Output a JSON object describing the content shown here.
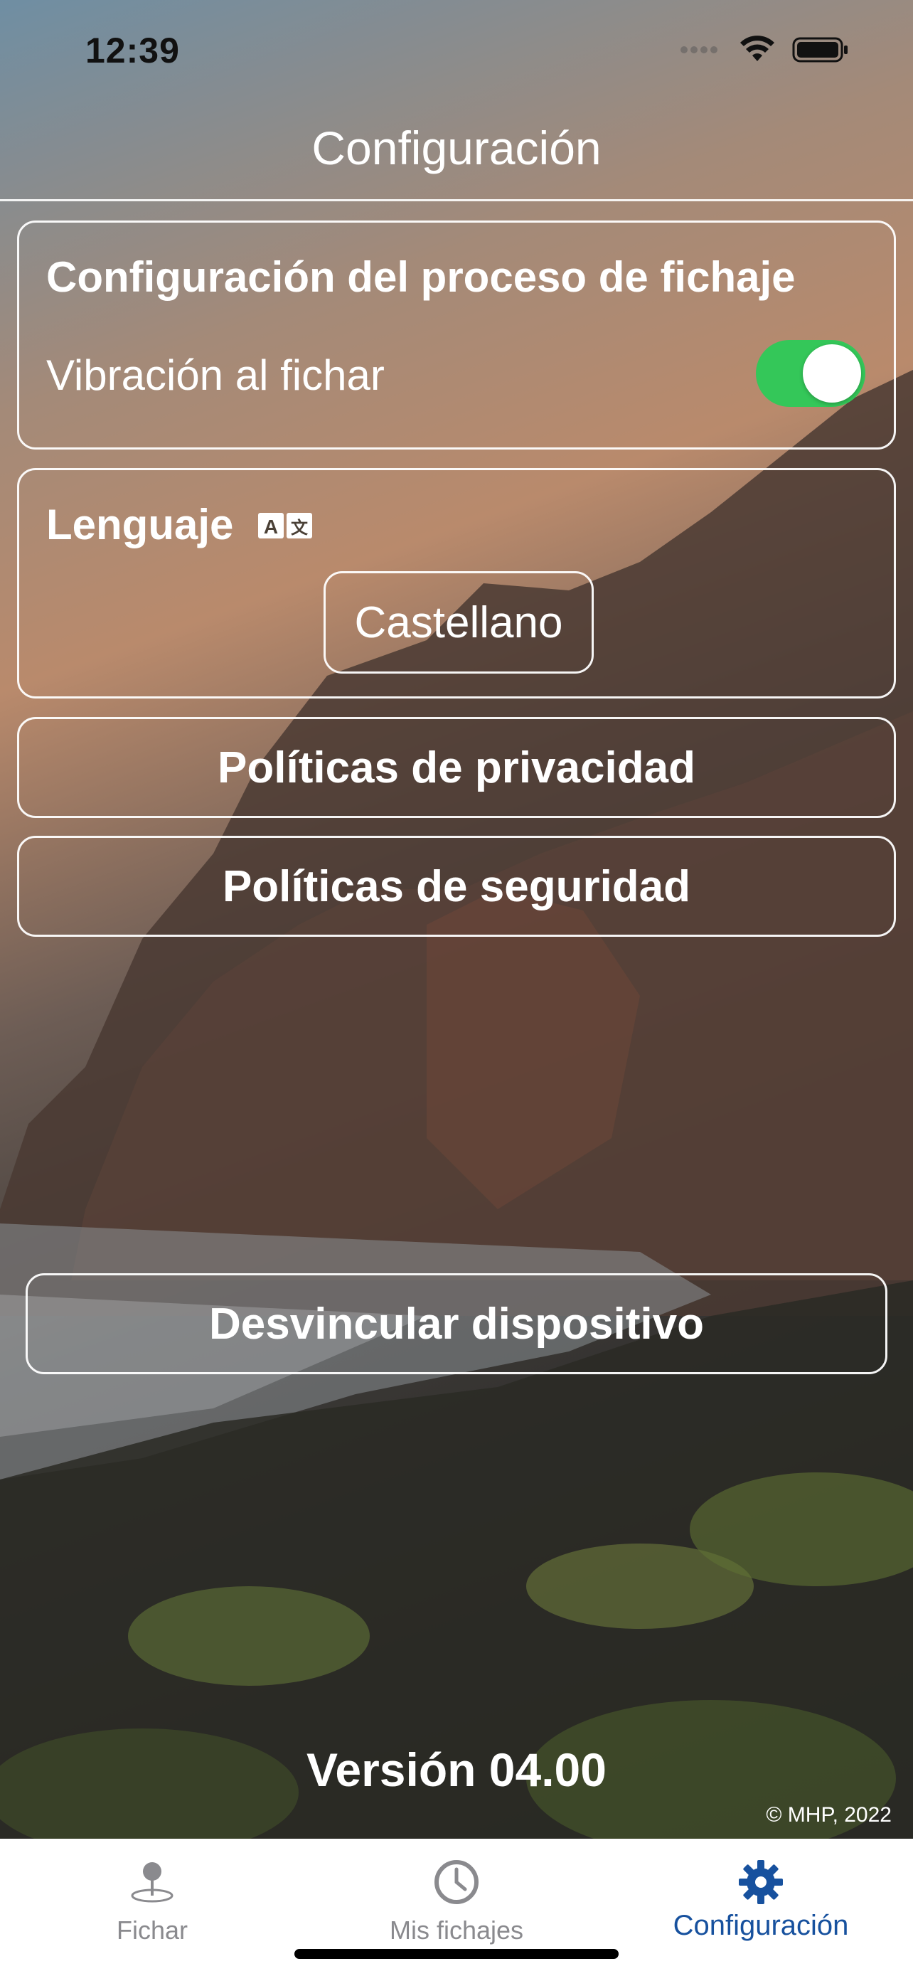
{
  "status_bar": {
    "time": "12:39"
  },
  "header": {
    "title": "Configuración"
  },
  "clocking_settings": {
    "title": "Configuración del proceso de fichaje",
    "vibration_label": "Vibración al fichar",
    "vibration_enabled": true
  },
  "language": {
    "title": "Lenguaje",
    "selected": "Castellano"
  },
  "buttons": {
    "privacy_policy": "Políticas de privacidad",
    "security_policy": "Políticas de seguridad",
    "unlink_device": "Desvincular dispositivo"
  },
  "footer": {
    "version": "Versión 04.00",
    "copyright": "© MHP, 2022"
  },
  "tabs": [
    {
      "label": "Fichar",
      "icon": "map-pin-icon",
      "active": false
    },
    {
      "label": "Mis fichajes",
      "icon": "clock-icon",
      "active": false
    },
    {
      "label": "Configuración",
      "icon": "gear-icon",
      "active": true
    }
  ],
  "colors": {
    "toggle_on": "#34c759",
    "tab_active": "#17519e",
    "tab_inactive": "#8a8a8e"
  }
}
